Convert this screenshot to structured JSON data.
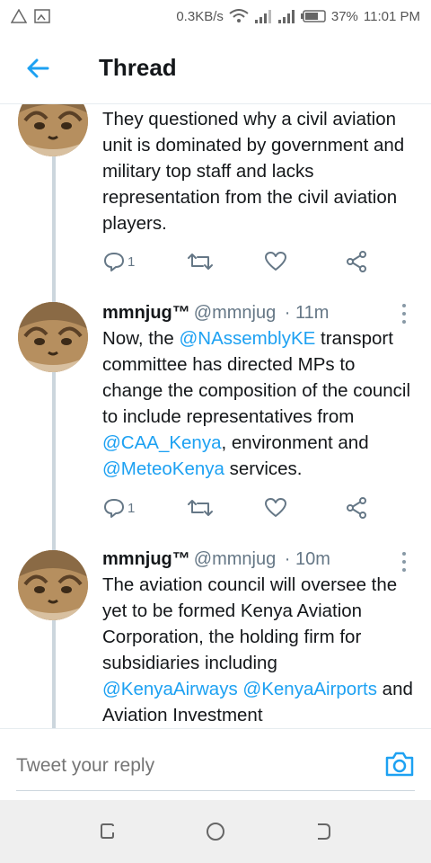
{
  "status_bar": {
    "network_speed": "0.3KB/s",
    "battery": "37%",
    "time": "11:01 PM"
  },
  "header": {
    "title": "Thread",
    "back_icon": "back-arrow-icon"
  },
  "colors": {
    "accent": "#1da1f2",
    "text": "#14171a",
    "secondary": "#657786",
    "thread_line": "#ccd6dd"
  },
  "tweets": [
    {
      "text_parts": [
        {
          "t": "They questioned why a civil aviation unit is dominated by government and military top staff and lacks representation from the civil aviation players.",
          "mention": false
        }
      ],
      "reply_count": "1"
    },
    {
      "name": "mmnjug™",
      "handle": "@mmnjug",
      "time": "· 11m",
      "text_parts": [
        {
          "t": "Now, the ",
          "mention": false
        },
        {
          "t": "@NAssemblyKE",
          "mention": true
        },
        {
          "t": " transport committee has directed MPs to change the composition of the council to include representatives from ",
          "mention": false
        },
        {
          "t": "@CAA_Kenya",
          "mention": true
        },
        {
          "t": ", environment and ",
          "mention": false
        },
        {
          "t": "@MeteoKenya",
          "mention": true
        },
        {
          "t": " services.",
          "mention": false
        }
      ],
      "reply_count": "1"
    },
    {
      "name": "mmnjug™",
      "handle": "@mmnjug",
      "time": "· 10m",
      "text_parts": [
        {
          "t": "The aviation council will oversee the yet to be formed Kenya Aviation Corporation, the holding firm for subsidiaries including ",
          "mention": false
        },
        {
          "t": "@KenyaAirways",
          "mention": true
        },
        {
          "t": " ",
          "mention": false
        },
        {
          "t": "@KenyaAirports",
          "mention": true
        },
        {
          "t": " and Aviation Investment",
          "mention": false
        }
      ]
    }
  ],
  "reply_bar": {
    "placeholder": "Tweet your reply",
    "camera_icon": "camera-icon"
  }
}
